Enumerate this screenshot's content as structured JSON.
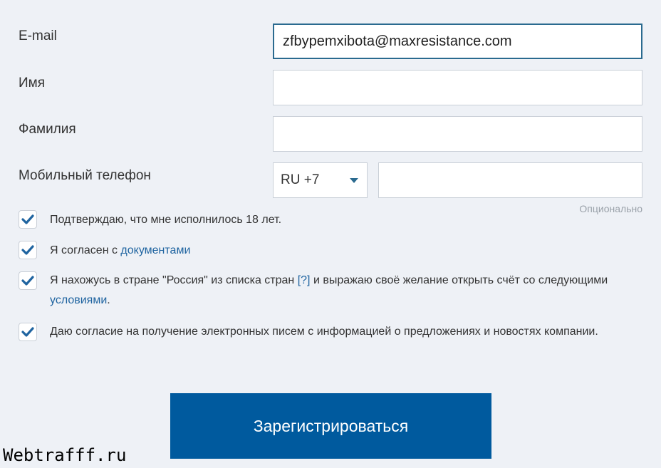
{
  "form": {
    "email": {
      "label": "E-mail",
      "value": "zfbypemxibota@maxresistance.com"
    },
    "first_name": {
      "label": "Имя",
      "value": ""
    },
    "last_name": {
      "label": "Фамилия",
      "value": ""
    },
    "phone": {
      "label": "Мобильный телефон",
      "country_code": "RU +7",
      "value": "",
      "hint": "Опционально"
    },
    "checks": [
      {
        "checked": true,
        "text": "Подтверждаю, что мне исполнилось 18 лет."
      },
      {
        "checked": true,
        "text_before": "Я согласен с ",
        "link": "документами"
      },
      {
        "checked": true,
        "text_before": "Я нахожусь в стране \"Россия\" из списка стран ",
        "help": "[?]",
        "text_middle": " и выражаю своё желание открыть счёт со следующими ",
        "link": "условиями",
        "text_after": "."
      },
      {
        "checked": true,
        "text": "Даю согласие на получение электронных писем с информацией о предложениях и новостях компании."
      }
    ],
    "submit_label": "Зарегистрироваться"
  },
  "watermark": "Webtrafff.ru",
  "colors": {
    "accent": "#005a9e",
    "link": "#1f64a0",
    "focus_border": "#2a6a8f",
    "background": "#eef1f6"
  },
  "icons": {
    "checkbox": "checkmark-icon",
    "select": "chevron-down-icon"
  }
}
